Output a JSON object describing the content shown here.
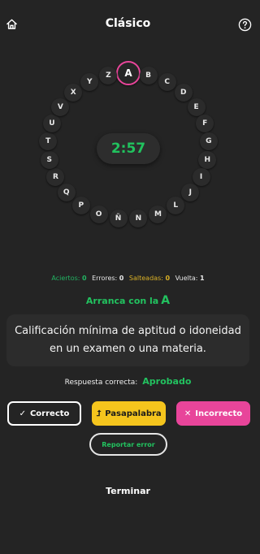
{
  "header": {
    "title": "Clásico",
    "home_icon": "home-icon",
    "help_icon": "help-icon"
  },
  "board": {
    "active_letter": "A",
    "letters": [
      "A",
      "B",
      "C",
      "D",
      "E",
      "F",
      "G",
      "H",
      "I",
      "J",
      "L",
      "M",
      "N",
      "Ñ",
      "O",
      "P",
      "Q",
      "R",
      "S",
      "T",
      "U",
      "V",
      "X",
      "Y",
      "Z"
    ],
    "timer": "2:57"
  },
  "stats": {
    "hits_label": "Aciertos:",
    "hits": "0",
    "errors_label": "Errores:",
    "errors": "0",
    "skipped_label": "Salteadas:",
    "skipped": "0",
    "round_label": "Vuelta:",
    "round": "1"
  },
  "prompt": {
    "starts_with_label": "Arranca con la",
    "starts_with_letter": "A"
  },
  "clue": "Calificación mínima de aptitud o idoneidad en un examen o una materia.",
  "answer": {
    "label": "Respuesta correcta:",
    "value": "Aprobado"
  },
  "actions": {
    "correct": "Correcto",
    "pass": "Pasapalabra",
    "incorrect": "Incorrecto",
    "report": "Reportar error",
    "finish": "Terminar"
  },
  "colors": {
    "background": "#242424",
    "green": "#22c25f",
    "yellow": "#f5c51d",
    "pink": "#e8459a",
    "skipped": "#d9b026"
  }
}
